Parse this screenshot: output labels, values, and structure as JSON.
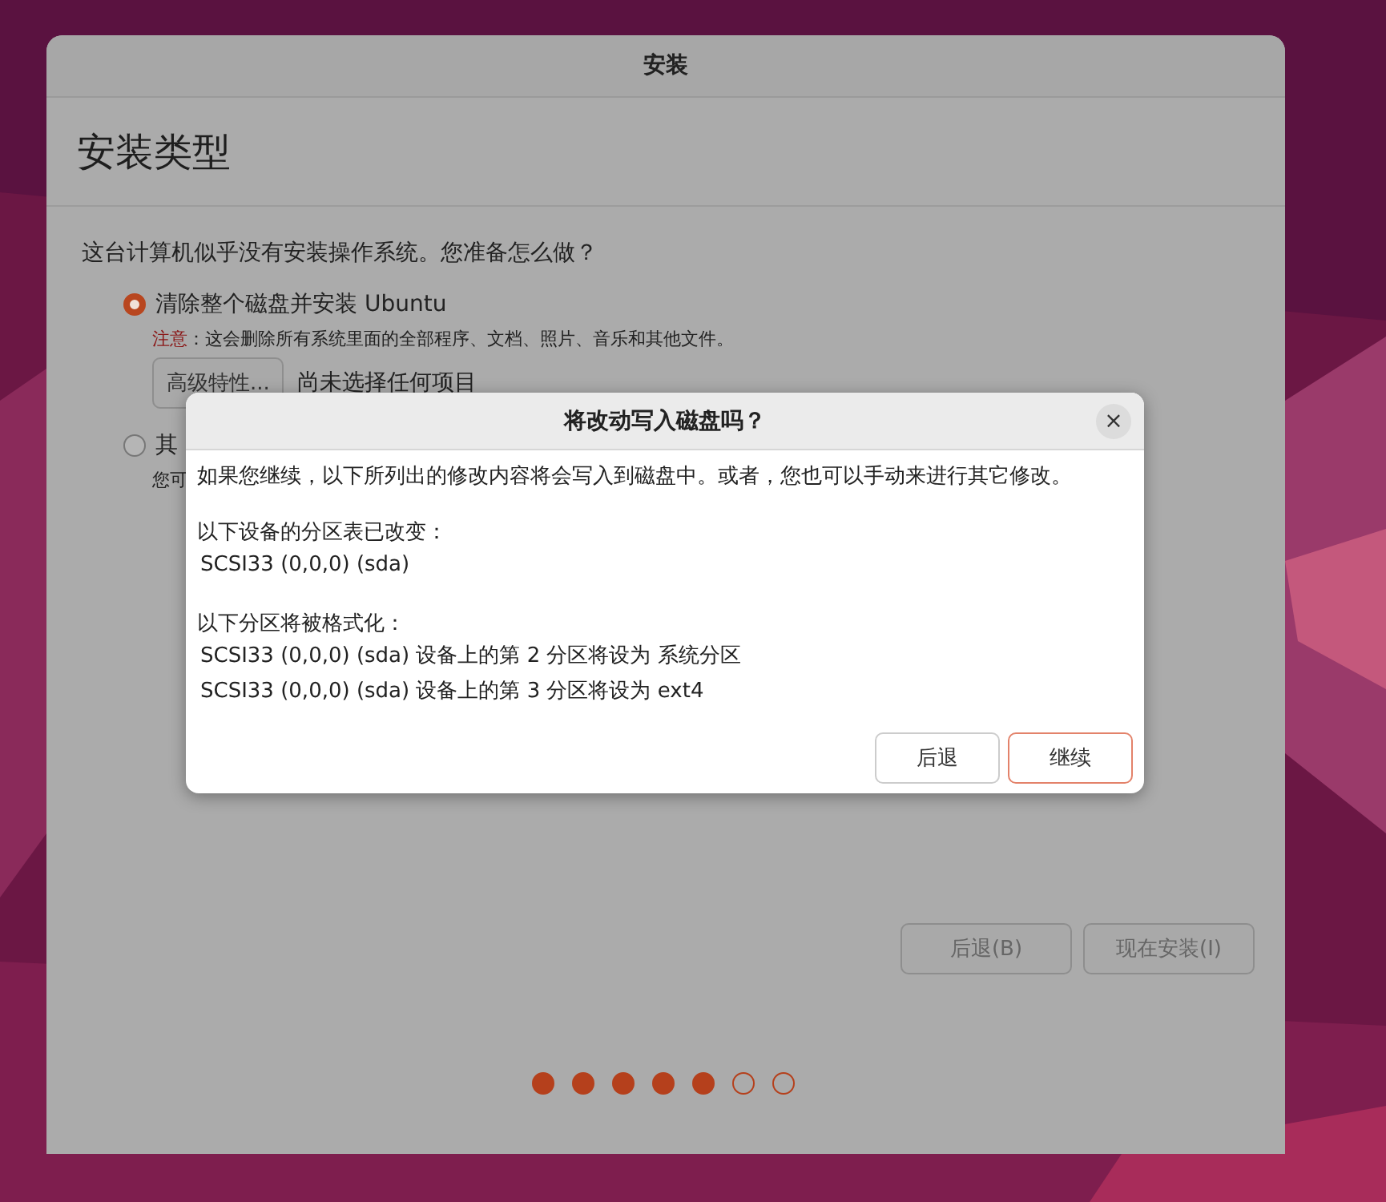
{
  "window": {
    "title": "安装"
  },
  "header": {
    "title": "安装类型"
  },
  "question": "这台计算机似乎没有安装操作系统。您准备怎么做？",
  "options": [
    {
      "label": "清除整个磁盘并安装 Ubuntu",
      "selected": true,
      "note_label": "注意",
      "note": "：这会删除所有系统里面的全部程序、文档、照片、音乐和其他文件。",
      "button": "高级特性...",
      "status": "尚未选择任何项目"
    },
    {
      "label": "其",
      "selected": false,
      "description": "您可"
    }
  ],
  "buttons": [
    {
      "label": "后退(B)"
    },
    {
      "label": "现在安装(I)"
    }
  ],
  "progress": [
    {
      "done": true
    },
    {
      "done": true
    },
    {
      "done": true
    },
    {
      "done": true
    },
    {
      "done": true
    },
    {
      "done": false
    },
    {
      "done": false
    }
  ],
  "dialog": {
    "title": "将改动写入磁盘吗？",
    "close": "×",
    "intro": "如果您继续，以下所列出的修改内容将会写入到磁盘中。或者，您也可以手动来进行其它修改。",
    "sections": [
      {
        "heading": "以下设备的分区表已改变：",
        "lines": [
          "SCSI33 (0,0,0) (sda)"
        ]
      },
      {
        "heading": "以下分区将被格式化：",
        "lines": [
          "SCSI33 (0,0,0) (sda) 设备上的第 2 分区将设为 系统分区",
          "SCSI33 (0,0,0) (sda) 设备上的第 3 分区将设为 ext4"
        ]
      }
    ],
    "buttons": [
      {
        "label": "后退",
        "kind": "normal"
      },
      {
        "label": "继续",
        "kind": "suggested"
      }
    ]
  }
}
